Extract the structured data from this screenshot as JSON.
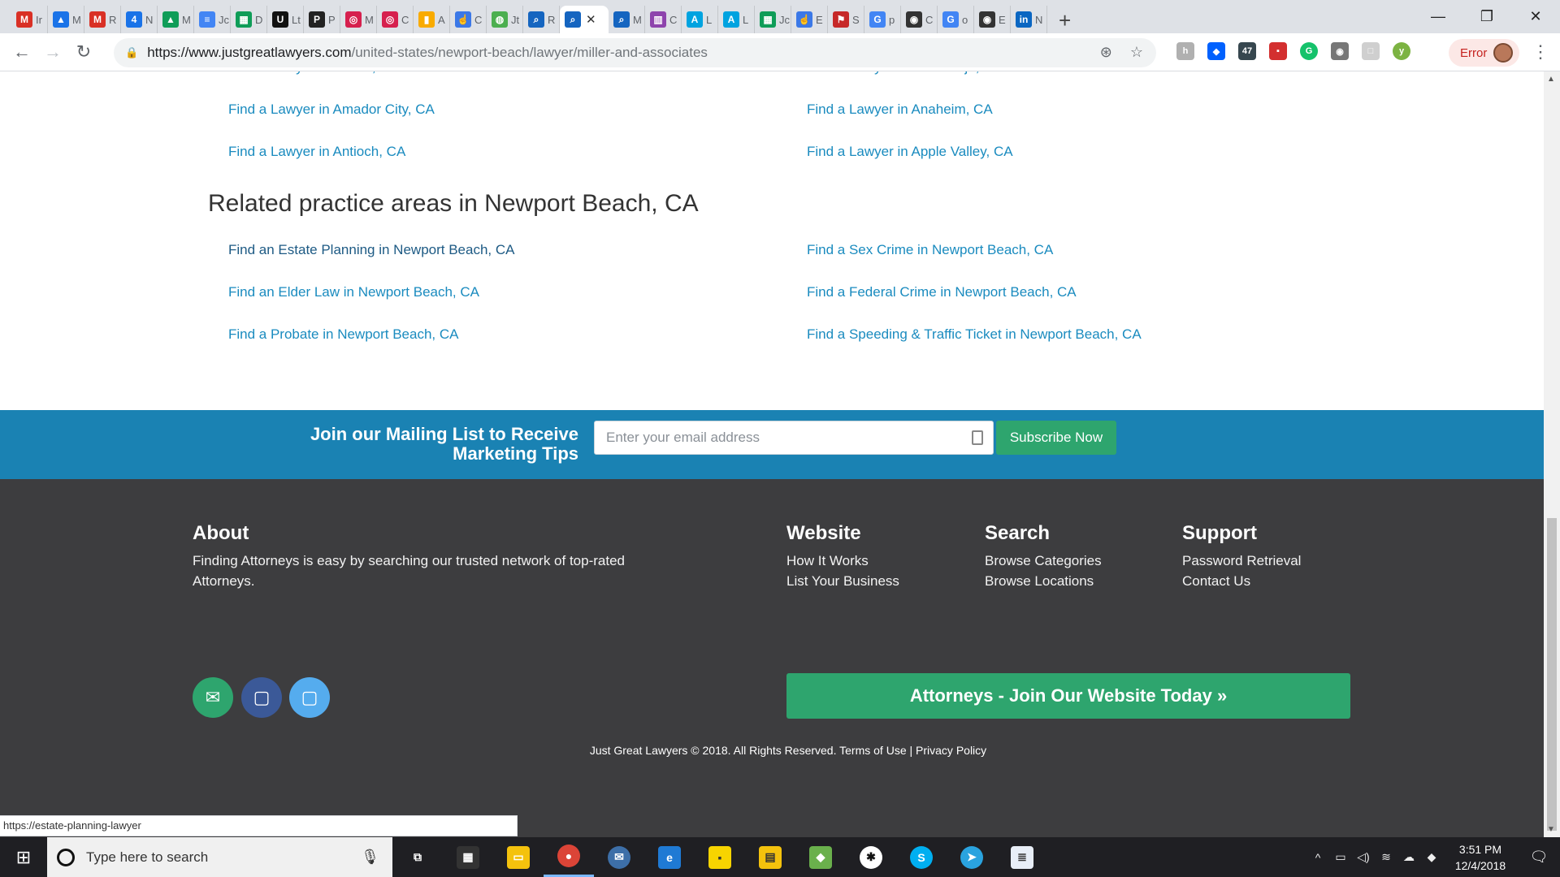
{
  "browser": {
    "tabs": [
      {
        "fav": "gmail-icon",
        "color": "#d93025",
        "glyph": "M",
        "label": "Ir"
      },
      {
        "fav": "drive-icon",
        "color": "#1a73e8",
        "glyph": "▲",
        "label": "M"
      },
      {
        "fav": "gmail-icon",
        "color": "#d93025",
        "glyph": "M",
        "label": "R"
      },
      {
        "fav": "calendar-icon",
        "color": "#1a73e8",
        "glyph": "4",
        "label": "N"
      },
      {
        "fav": "drive-icon",
        "color": "#0f9d58",
        "glyph": "▲",
        "label": "M"
      },
      {
        "fav": "docs-icon",
        "color": "#4285f4",
        "glyph": "≡",
        "label": "Jc"
      },
      {
        "fav": "sheets-icon",
        "color": "#0f9d58",
        "glyph": "▦",
        "label": "D"
      },
      {
        "fav": "u-icon",
        "color": "#111111",
        "glyph": "U",
        "label": "Lt"
      },
      {
        "fav": "pitchbox-icon",
        "color": "#222222",
        "glyph": "P",
        "label": "P"
      },
      {
        "fav": "target-icon",
        "color": "#d6204e",
        "glyph": "◎",
        "label": "M"
      },
      {
        "fav": "target-icon",
        "color": "#d6204e",
        "glyph": "◎",
        "label": "C"
      },
      {
        "fav": "analytics-icon",
        "color": "#f9ab00",
        "glyph": "▮",
        "label": "A"
      },
      {
        "fav": "hand-icon",
        "color": "#3b78e7",
        "glyph": "☝",
        "label": "C"
      },
      {
        "fav": "globe-icon",
        "color": "#4caf50",
        "glyph": "◍",
        "label": "Jt"
      },
      {
        "fav": "search-icon",
        "color": "#1565c0",
        "glyph": "⌕",
        "label": "R"
      },
      {
        "fav": "search-icon",
        "color": "#1565c0",
        "glyph": "⌕",
        "label": "",
        "active": true
      },
      {
        "fav": "search-icon",
        "color": "#1565c0",
        "glyph": "⌕",
        "label": "M"
      },
      {
        "fav": "trello-icon",
        "color": "#8e44ad",
        "glyph": "▥",
        "label": "C"
      },
      {
        "fav": "a-icon",
        "color": "#00a3e0",
        "glyph": "A",
        "label": "L"
      },
      {
        "fav": "a-icon",
        "color": "#00a3e0",
        "glyph": "A",
        "label": "L"
      },
      {
        "fav": "sheets-icon",
        "color": "#0f9d58",
        "glyph": "▦",
        "label": "Jc"
      },
      {
        "fav": "hand-icon",
        "color": "#3b78e7",
        "glyph": "☝",
        "label": "E"
      },
      {
        "fav": "flag-icon",
        "color": "#c62828",
        "glyph": "⚑",
        "label": "S"
      },
      {
        "fav": "google-icon",
        "color": "#4285f4",
        "glyph": "G",
        "label": "p"
      },
      {
        "fav": "eye-icon",
        "color": "#333333",
        "glyph": "◉",
        "label": "C"
      },
      {
        "fav": "google-icon",
        "color": "#4285f4",
        "glyph": "G",
        "label": "o"
      },
      {
        "fav": "eye-icon",
        "color": "#333333",
        "glyph": "◉",
        "label": "E"
      },
      {
        "fav": "linkedin-icon",
        "color": "#0a66c2",
        "glyph": "in",
        "label": "N"
      }
    ],
    "url_host": "https://www.justgreatlawyers.com",
    "url_path": "/united-states/newport-beach/lawyer/miller-and-associates",
    "error_label": "Error",
    "status_url": "https://estate-planning-lawyer"
  },
  "page": {
    "city_links": [
      {
        "text": "Find a Lawyer in Alamo, CA",
        "col": 0,
        "row": -1
      },
      {
        "text": "Find a Lawyer in Aliso Viejo, CA",
        "col": 1,
        "row": -1
      },
      {
        "text": "Find a Lawyer in Amador City, CA",
        "col": 0,
        "row": 0
      },
      {
        "text": "Find a Lawyer in Anaheim, CA",
        "col": 1,
        "row": 0
      },
      {
        "text": "Find a Lawyer in Antioch, CA",
        "col": 0,
        "row": 1
      },
      {
        "text": "Find a Lawyer in Apple Valley, CA",
        "col": 1,
        "row": 1
      }
    ],
    "related_heading": "Related practice areas in Newport Beach, CA",
    "practice_links": [
      {
        "text": "Find an Estate Planning in Newport Beach, CA",
        "col": 0,
        "row": 0,
        "hover": true
      },
      {
        "text": "Find a Sex Crime in Newport Beach, CA",
        "col": 1,
        "row": 0
      },
      {
        "text": "Find an Elder Law in Newport Beach, CA",
        "col": 0,
        "row": 1
      },
      {
        "text": "Find a Federal Crime in Newport Beach, CA",
        "col": 1,
        "row": 1
      },
      {
        "text": "Find a Probate in Newport Beach, CA",
        "col": 0,
        "row": 2
      },
      {
        "text": "Find a Speeding & Traffic Ticket in Newport Beach, CA",
        "col": 1,
        "row": 2
      }
    ],
    "mailing": {
      "title_line1": "Join our Mailing List to Receive",
      "title_line2": "Marketing Tips",
      "email_placeholder": "Enter your email address",
      "subscribe_label": "Subscribe Now"
    },
    "footer": {
      "about_heading": "About",
      "about_text": "Finding Attorneys is easy by searching our trusted network of top-rated Attorneys.",
      "website_heading": "Website",
      "website_links": [
        "How It Works",
        "List Your Business"
      ],
      "search_heading": "Search",
      "search_links": [
        "Browse Categories",
        "Browse Locations"
      ],
      "support_heading": "Support",
      "support_links": [
        "Password Retrieval",
        "Contact Us"
      ],
      "join_label": "Attorneys - Join Our Website Today »",
      "copyright": "Just Great Lawyers © 2018. All Rights Reserved.",
      "terms": "Terms of Use",
      "privacy": "Privacy Policy",
      "colors": {
        "footer_bg": "#3d3d3f",
        "band": "#1a82b3",
        "green": "#2ea56e",
        "link": "#1a8bbf"
      }
    }
  },
  "taskbar": {
    "search_placeholder": "Type here to search",
    "time": "3:51 PM",
    "date": "12/4/2018"
  }
}
